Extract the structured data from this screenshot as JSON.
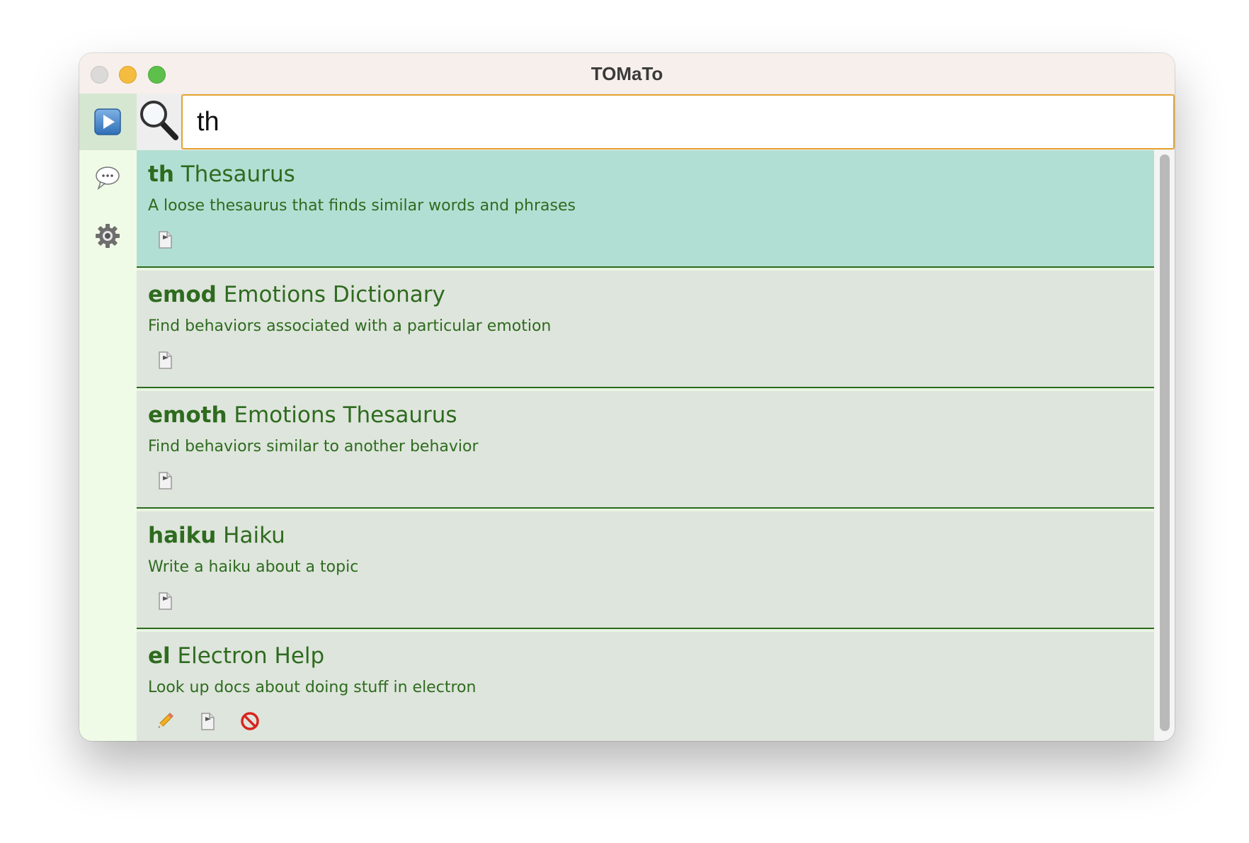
{
  "window": {
    "title": "TOMaTo"
  },
  "search": {
    "value": "th"
  },
  "sidebar": {
    "items": [
      {
        "icon": "play-icon"
      },
      {
        "icon": "chat-bubble-icon"
      },
      {
        "icon": "gear-icon"
      }
    ]
  },
  "results": [
    {
      "keyword": "th",
      "name": "Thesaurus",
      "description": "A loose thesaurus that finds similar words and phrases",
      "selected": true,
      "actions": [
        "document-icon"
      ]
    },
    {
      "keyword": "emod",
      "name": "Emotions Dictionary",
      "description": "Find behaviors associated with a particular emotion",
      "selected": false,
      "actions": [
        "document-icon"
      ]
    },
    {
      "keyword": "emoth",
      "name": "Emotions Thesaurus",
      "description": "Find behaviors similar to another behavior",
      "selected": false,
      "actions": [
        "document-icon"
      ]
    },
    {
      "keyword": "haiku",
      "name": "Haiku",
      "description": "Write a haiku about a topic",
      "selected": false,
      "actions": [
        "document-icon"
      ]
    },
    {
      "keyword": "el",
      "name": "Electron Help",
      "description": "Look up docs about doing stuff in electron",
      "selected": false,
      "actions": [
        "pencil-icon",
        "document-icon",
        "prohibited-icon"
      ]
    }
  ],
  "colors": {
    "selected_row": "#b2dfd3",
    "row": "#dee5dc",
    "text": "#2e6b1f",
    "input_border": "#e4a22e"
  }
}
